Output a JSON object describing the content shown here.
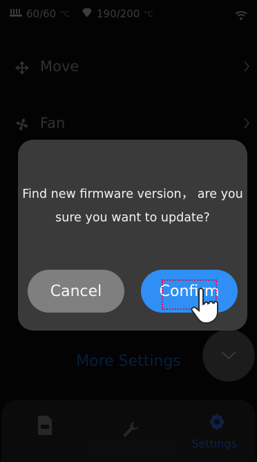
{
  "status_bar": {
    "bed_temp": "60/60",
    "bed_unit": "°C",
    "nozzle_temp": "190/200",
    "nozzle_unit": "°C"
  },
  "menu": [
    {
      "label": "Move",
      "icon": "move-icon"
    },
    {
      "label": "Fan",
      "icon": "fan-icon"
    }
  ],
  "more_settings": "More Settings",
  "tabs": [
    {
      "label": "",
      "icon": "files-icon"
    },
    {
      "label": "",
      "icon": "wrench-icon"
    },
    {
      "label": "Settings",
      "icon": "settings-gear-icon"
    }
  ],
  "dialog": {
    "message": "Find new firmware version， are you sure you want to update?",
    "cancel_label": "Cancel",
    "confirm_label": "Confirm"
  },
  "colors": {
    "accent": "#2f8ff5",
    "dialog_bg": "#3a3a3a",
    "cancel_bg": "#7f7f7f"
  }
}
